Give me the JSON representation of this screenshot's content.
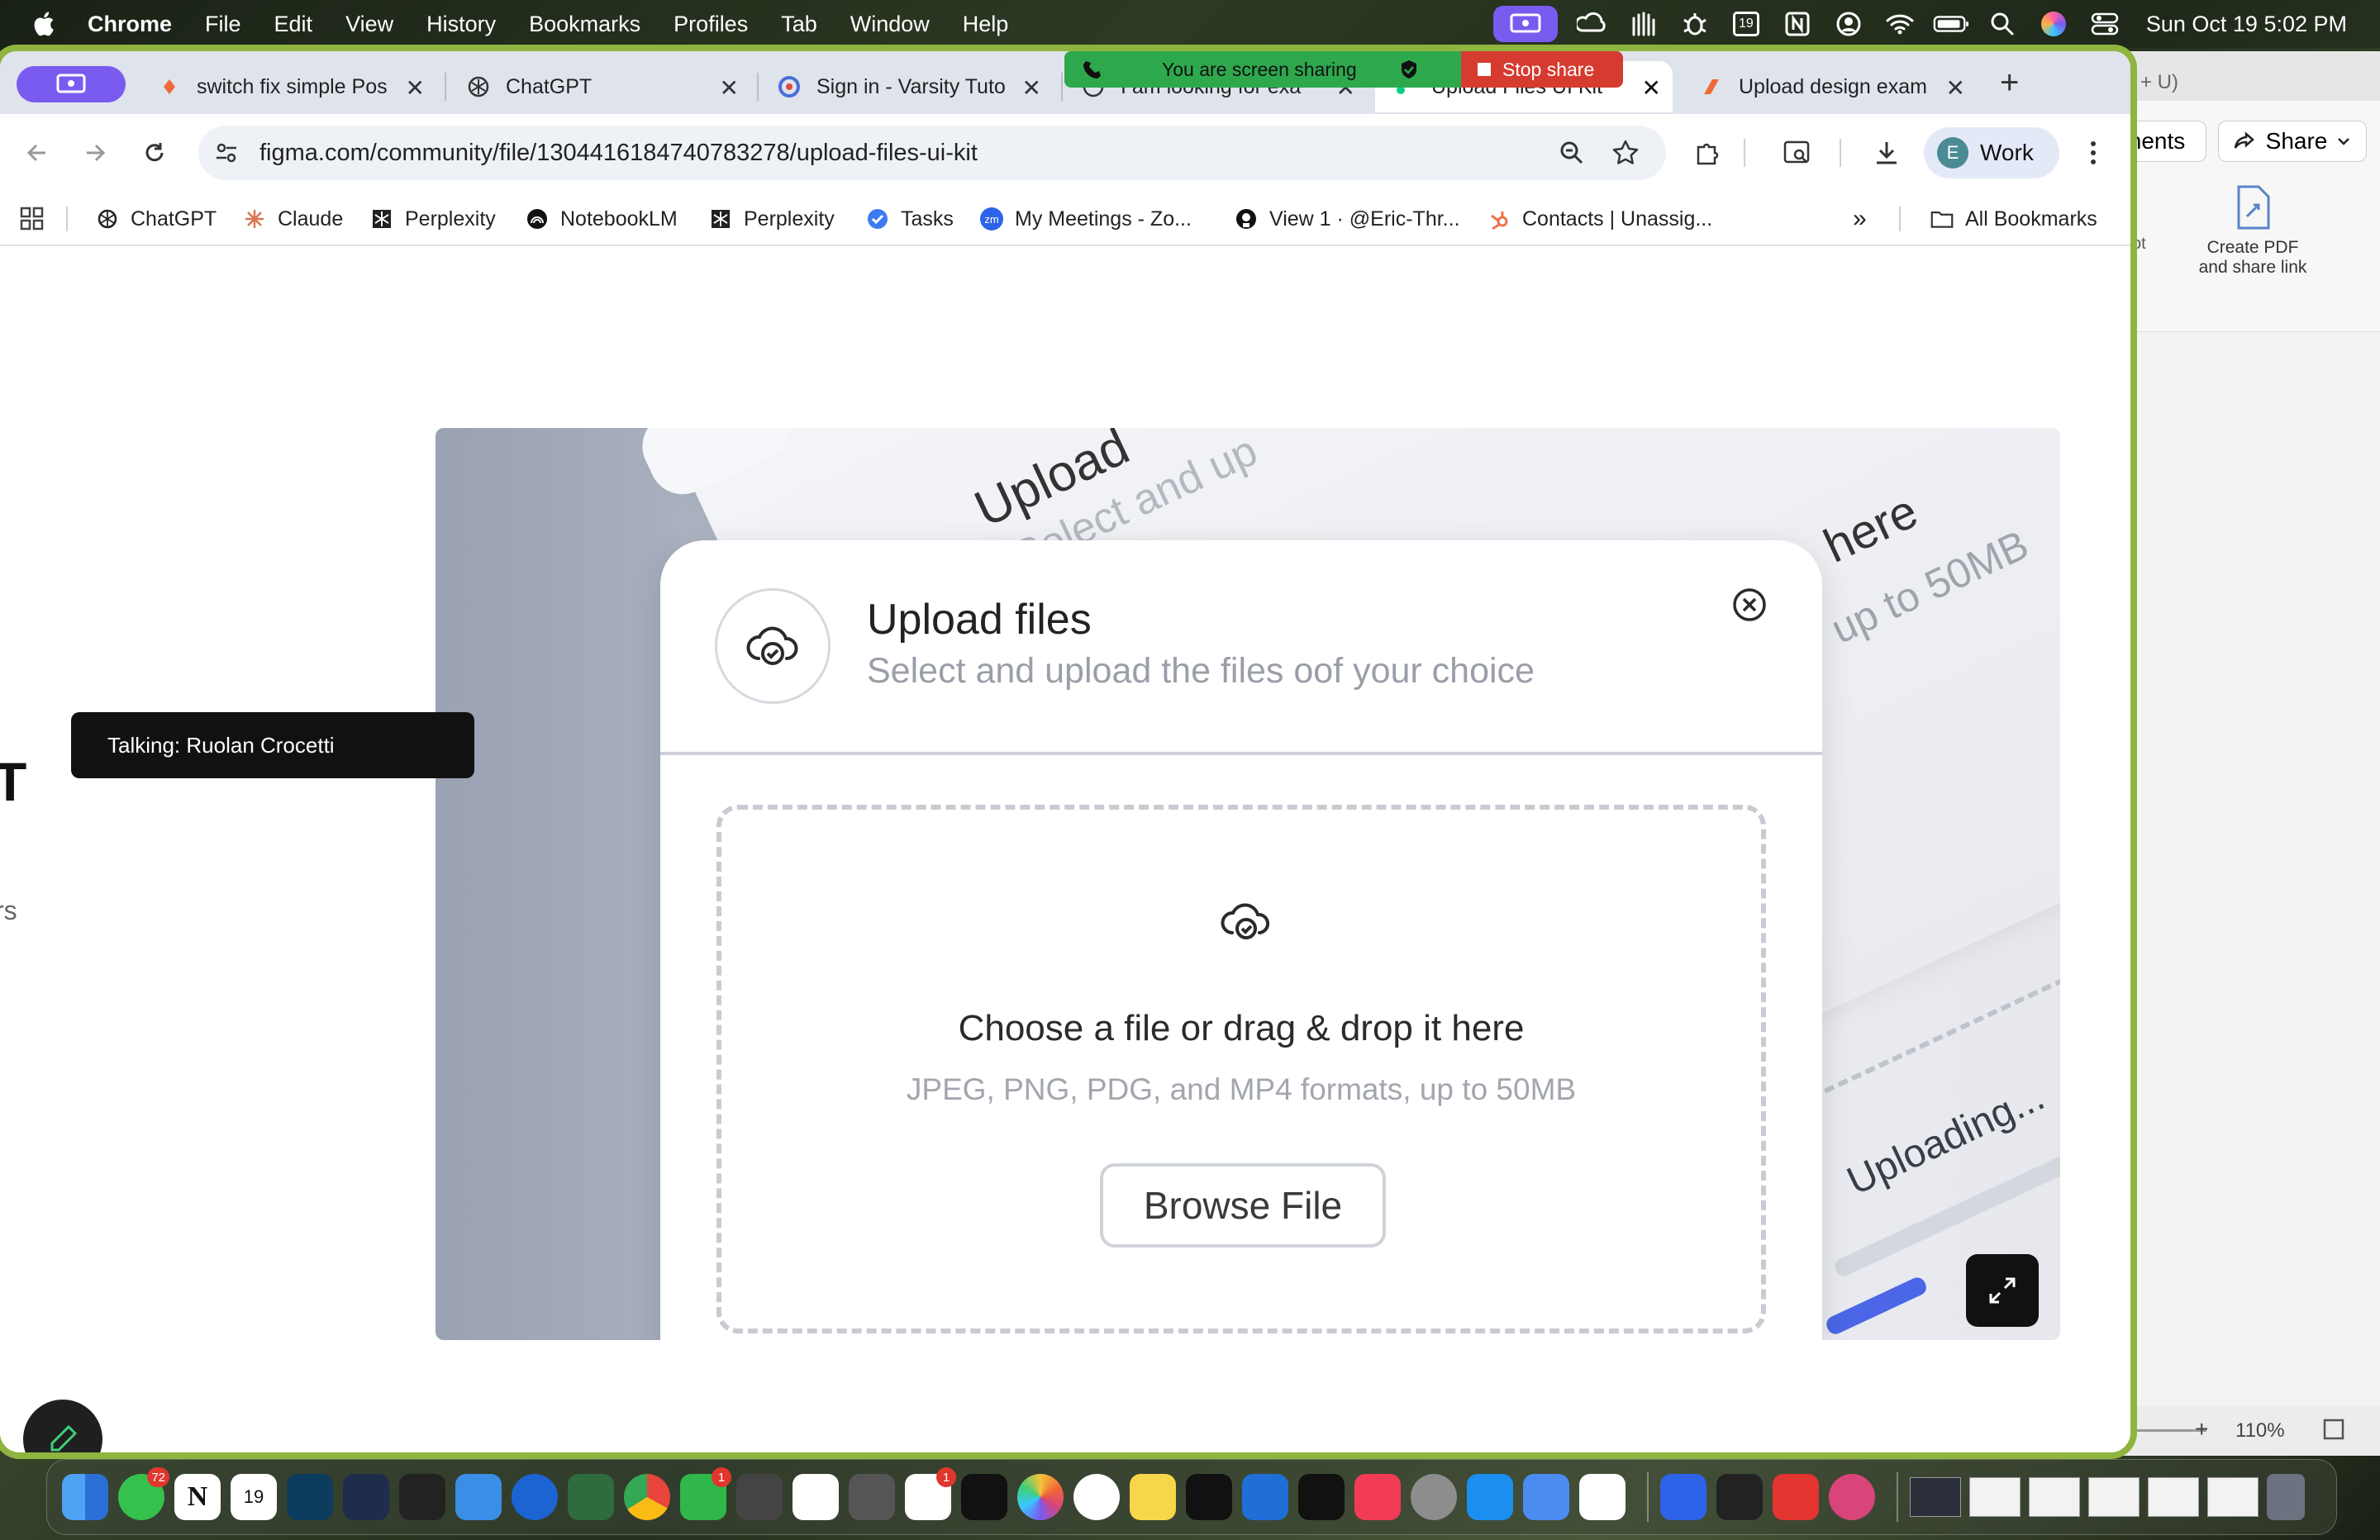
{
  "menubar": {
    "app": "Chrome",
    "items": [
      "File",
      "Edit",
      "View",
      "History",
      "Bookmarks",
      "Profiles",
      "Tab",
      "Window",
      "Help"
    ],
    "clock": "Sun Oct 19  5:02 PM",
    "calendar_day": "19"
  },
  "screenshare": {
    "message": "You are screen sharing",
    "stop_label": "Stop share"
  },
  "tabs": [
    {
      "title": "switch fix simple Pos",
      "icon": "figma-icon"
    },
    {
      "title": "ChatGPT",
      "icon": "openai-icon"
    },
    {
      "title": "Sign in - Varsity Tuto",
      "icon": "varsity-icon"
    },
    {
      "title": "I am looking for exa",
      "icon": "chatgpt-icon"
    },
    {
      "title": "Upload Files UI Kit",
      "icon": "figma-icon",
      "active": true
    },
    {
      "title": "Upload design exam",
      "icon": "figma-icon"
    }
  ],
  "toolbar": {
    "url": "figma.com/community/file/1304416184740783278/upload-files-ui-kit",
    "profile_initial": "E",
    "profile_label": "Work"
  },
  "bookmarks": [
    {
      "label": "ChatGPT"
    },
    {
      "label": "Claude"
    },
    {
      "label": "Perplexity"
    },
    {
      "label": "NotebookLM"
    },
    {
      "label": "Perplexity"
    },
    {
      "label": "Tasks"
    },
    {
      "label": "My Meetings - Zo..."
    },
    {
      "label": "View 1 · @Eric-Thr..."
    },
    {
      "label": "Contacts | Unassig..."
    }
  ],
  "bookmarks_all": "All Bookmarks",
  "page": {
    "talking": "Talking: Ruolan Crocetti",
    "left_heading_fragment": "T",
    "left_sub_fragment": "rs",
    "background_texts": {
      "upload": "Upload",
      "select": "Select and up",
      "here": "here",
      "limit": "up to 50MB",
      "uploading": "Uploading..."
    },
    "modal": {
      "title": "Upload files",
      "subtitle": "Select and upload the files oof your choice",
      "drop_heading": "Choose a file or drag & drop it here",
      "drop_formats": "JPEG, PNG, PDG, and MP4 formats, up to 50MB",
      "browse_label": "Browse File"
    }
  },
  "behind_window": {
    "header_fragment": "+ U)",
    "comments_fragment": "nents",
    "share_label": "Share",
    "ot_fragment": "ot",
    "pdf_label_line1": "Create PDF",
    "pdf_label_line2": "and share link",
    "zoom": "110%"
  },
  "dock": {
    "messages_badge": "72",
    "facetime_badge": "1",
    "reminders_badge": "1"
  },
  "colors": {
    "accent_purple": "#7a5bf0",
    "share_green": "#2ea84d",
    "share_red": "#d63b2f",
    "window_border": "#8fb43f"
  }
}
